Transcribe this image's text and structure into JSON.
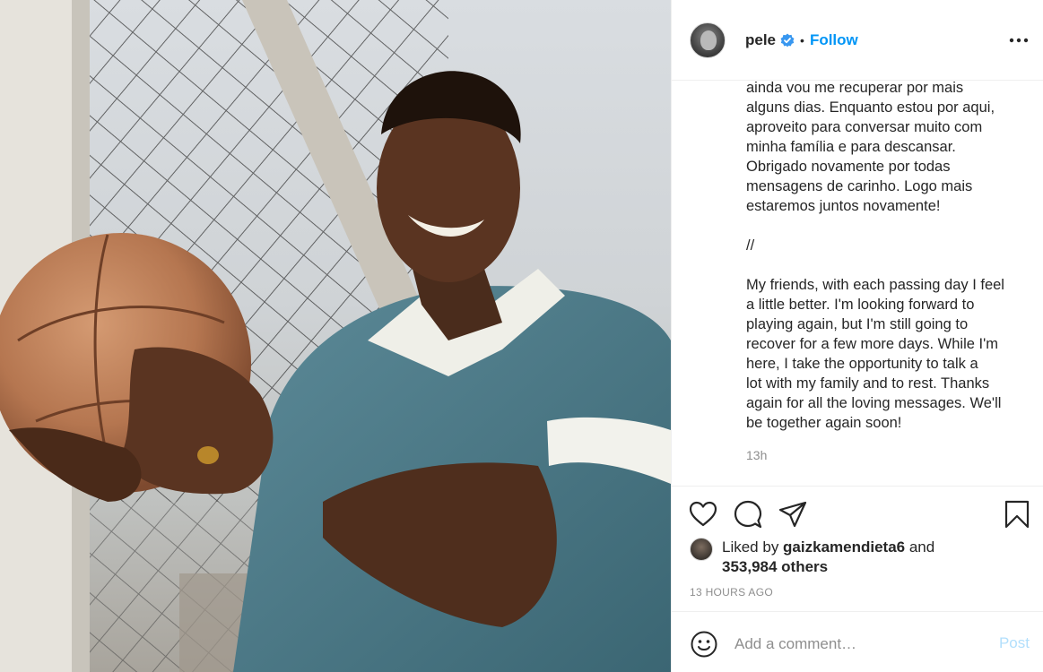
{
  "post": {
    "username": "pele",
    "verified_icon": "verified-badge-icon",
    "separator": "•",
    "follow_label": "Follow",
    "more_icon": "more-options-icon"
  },
  "caption": {
    "portuguese_end": "ainda vou me recuperar por mais\nalguns dias. Enquanto estou por aqui,\naproveito para conversar muito com\nminha família e para descansar.\nObrigado novamente por todas\nmensagens de carinho. Logo mais\nestaremos juntos novamente!",
    "separator": "//",
    "english": "My friends, with each passing day I feel\na little better. I'm looking forward to\nplaying again, but I'm still going to\nrecover for a few more days. While I'm\nhere, I take the opportunity to talk a\nlot with my family and to rest. Thanks\nagain for all the loving messages. We'll\nbe together again soon!",
    "time": "13h"
  },
  "actions": {
    "like_icon": "heart-icon",
    "comment_icon": "comment-icon",
    "share_icon": "share-icon",
    "save_icon": "bookmark-icon"
  },
  "likes": {
    "prefix": "Liked by ",
    "user": "gaizkamendieta6",
    "conj": " and",
    "count": "353,984 others"
  },
  "age": "13 HOURS AGO",
  "comment": {
    "placeholder": "Add a comment…",
    "post_label": "Post"
  },
  "colors": {
    "accent": "#0095f6",
    "post_disabled": "#b2dffc",
    "text": "#262626",
    "muted": "#8e8e8e"
  }
}
